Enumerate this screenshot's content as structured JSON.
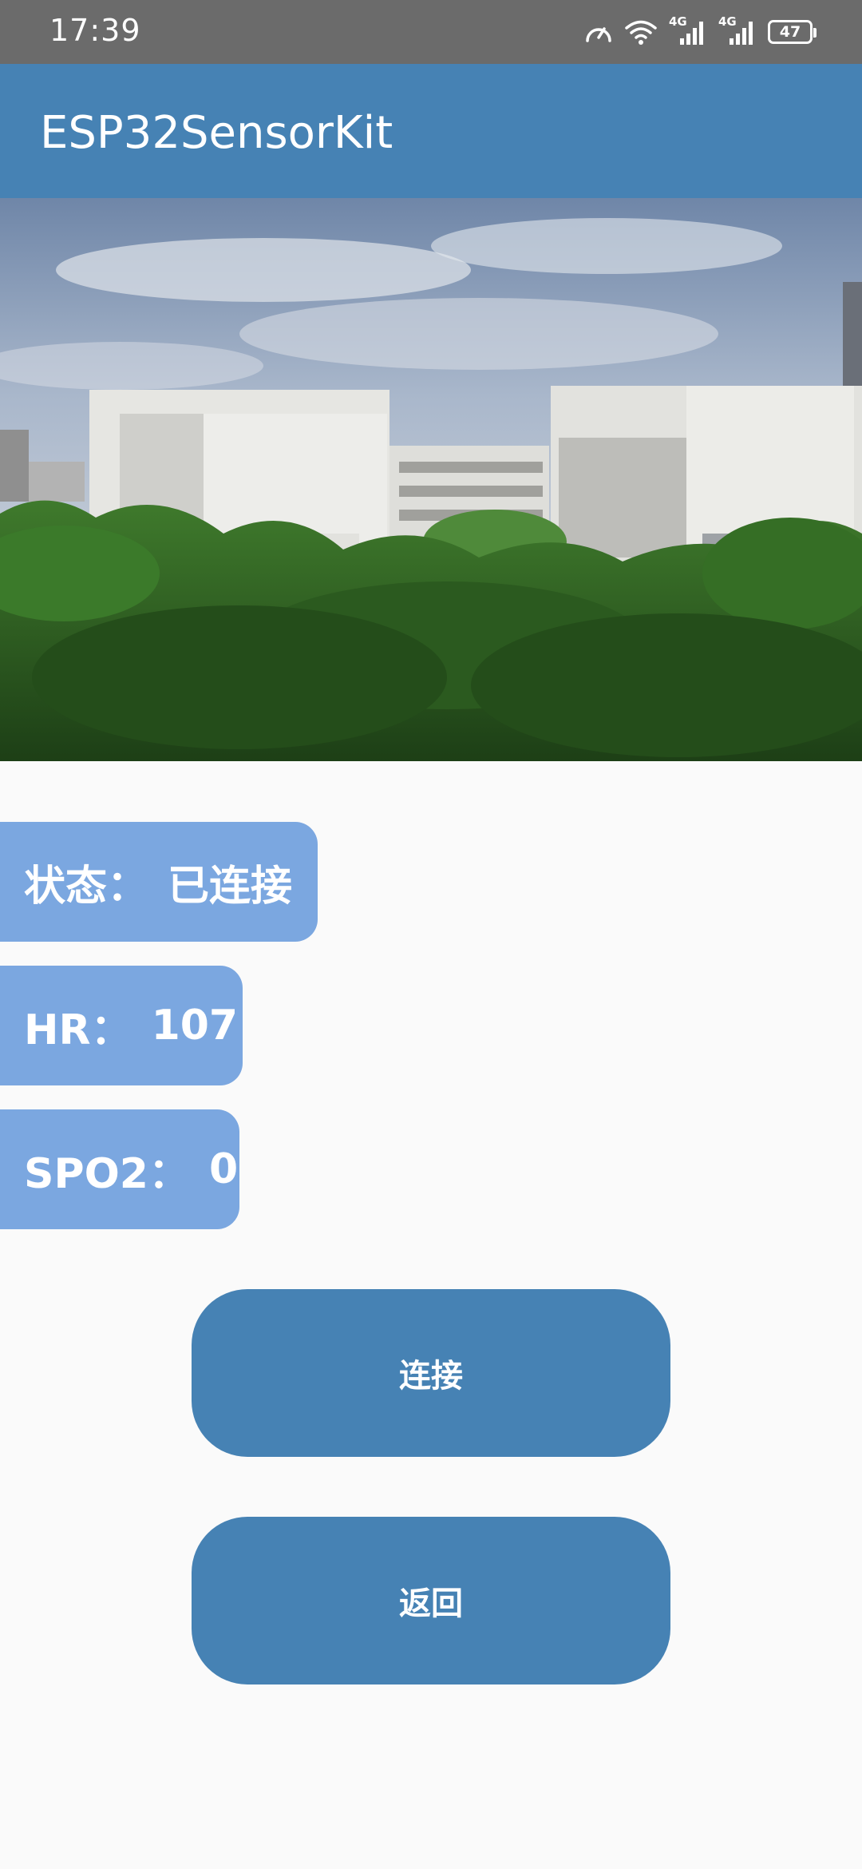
{
  "status_bar": {
    "time": "17:39",
    "battery": "47",
    "network_label": "4G",
    "icons": [
      "speed-meter-icon",
      "wifi-icon",
      "signal-4g-icon",
      "signal-4g-icon",
      "battery-icon"
    ]
  },
  "app_bar": {
    "title": "ESP32SensorKit",
    "color": "#4682b4"
  },
  "hero": {
    "image": "campus-building-photo"
  },
  "info": {
    "status_label": "状态：",
    "status_value": "已连接",
    "hr_label": "HR：",
    "hr_value": "107",
    "spo2_label": "SPO2：",
    "spo2_value": "0",
    "chip_color": "#7ba7e0"
  },
  "buttons": {
    "connect_label": "连接",
    "back_label": "返回",
    "color": "#4682b4"
  }
}
